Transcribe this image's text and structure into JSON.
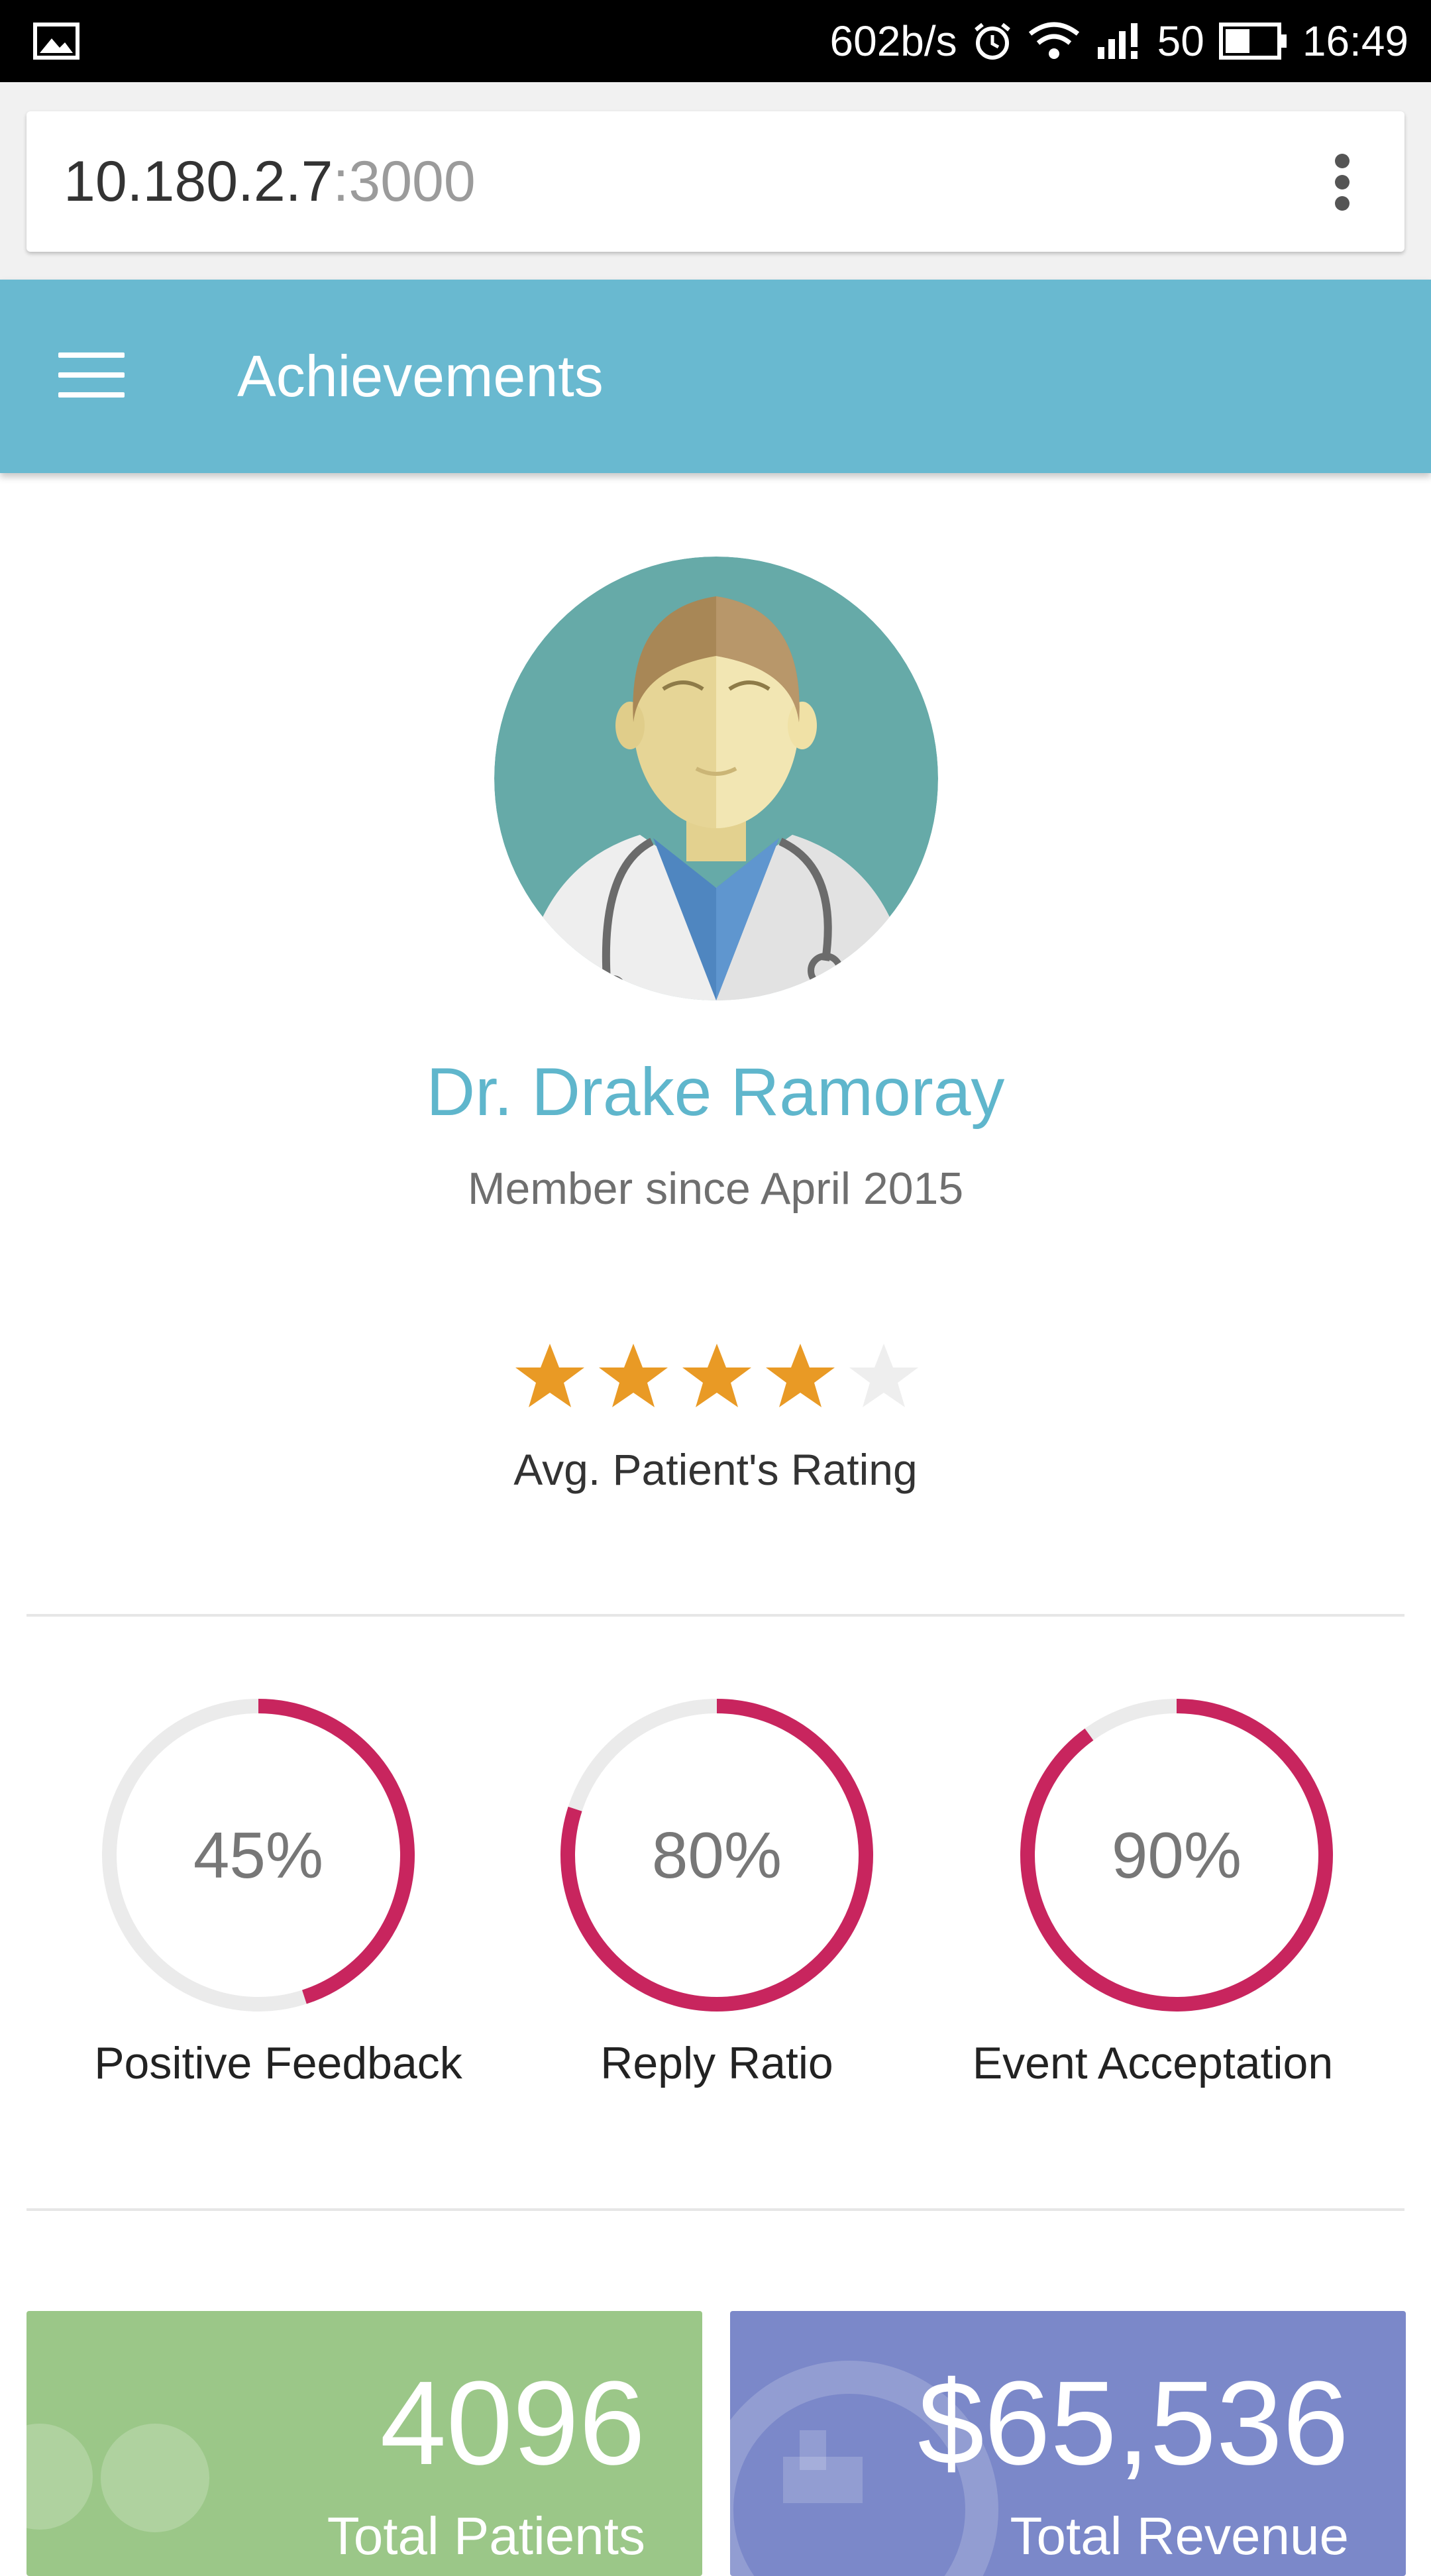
{
  "status_bar": {
    "network_speed": "602b/s",
    "battery": "50",
    "time": "16:49",
    "icons": [
      "image-icon",
      "alarm-icon",
      "wifi-icon",
      "signal-icon",
      "battery-icon"
    ]
  },
  "browser": {
    "url_host": "10.180.2.7",
    "url_port": ":3000",
    "menu_icon": "more-vert-icon"
  },
  "app_bar": {
    "title": "Achievements",
    "menu_icon": "hamburger-menu-icon",
    "color": "#69b9d0"
  },
  "profile": {
    "name": "Dr. Drake Ramoray",
    "member_since": "Member since April 2015",
    "rating": 4,
    "rating_max": 5,
    "rating_label": "Avg. Patient's Rating"
  },
  "metrics": [
    {
      "value": "45%",
      "percent": 45,
      "label": "Positive Feedback"
    },
    {
      "value": "80%",
      "percent": 80,
      "label": "Reply Ratio"
    },
    {
      "value": "90%",
      "percent": 90,
      "label": "Event Acceptation"
    }
  ],
  "stats": [
    {
      "value": "4096",
      "label": "Total Patients",
      "color": "#9bc788"
    },
    {
      "value": "$65,536",
      "label": "Total Revenue",
      "color": "#7b88c9"
    }
  ],
  "colors": {
    "accent": "#5fb6cc",
    "ring": "#c8255e",
    "ring_track": "#ebebeb",
    "star": "#e99a25",
    "star_empty": "#eeeeee"
  }
}
